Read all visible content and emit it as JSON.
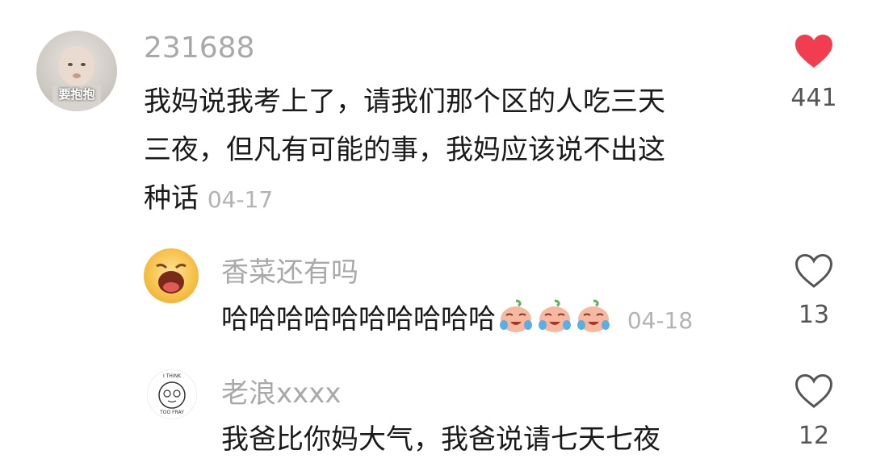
{
  "comments": [
    {
      "username": "231688",
      "avatar_caption": "要抱抱",
      "text_lines": [
        "我妈说我考上了，请我们那个区的人吃三天",
        "三夜，但凡有可能的事，我妈应该说不出这",
        "种话"
      ],
      "date": "04-17",
      "likes": "441",
      "liked": true
    },
    {
      "username": "香菜还有吗",
      "text": "哈哈哈哈哈哈哈哈哈哈",
      "emoji": [
        "crying-laugh-emoji",
        "crying-laugh-emoji",
        "crying-laugh-emoji"
      ],
      "date": "04-18",
      "likes": "13",
      "liked": false
    },
    {
      "username": "老浪xxxx",
      "avatar_caption_top": "I THINK",
      "avatar_caption_bottom": "TOO FRAY",
      "text": "我爸比你妈大气，我爸说请七天七夜",
      "likes": "12",
      "liked": false
    }
  ],
  "colors": {
    "liked_heart": "#f23c4f",
    "username": "#a9a9a9",
    "text": "#1a1a1a",
    "date": "#b3b3b3"
  }
}
